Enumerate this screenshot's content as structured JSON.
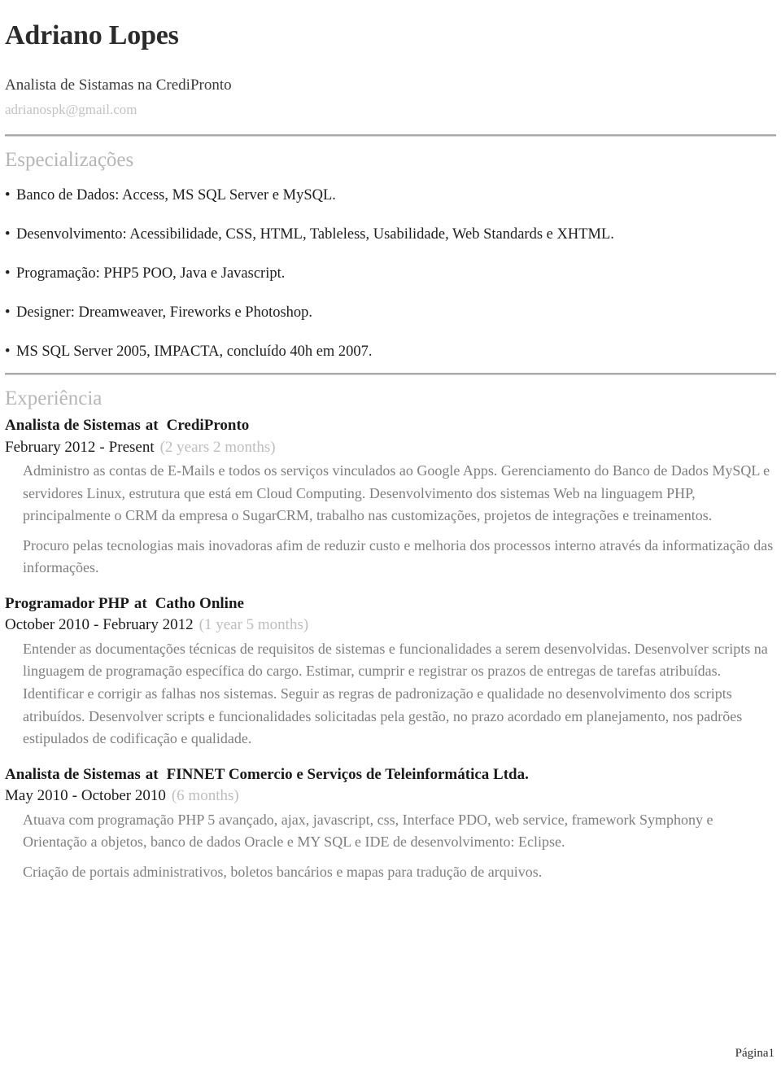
{
  "header": {
    "name": "Adriano Lopes",
    "headline": "Analista de Sistamas na CrediPronto",
    "email": "adrianospk@gmail.com"
  },
  "specializations": {
    "title": "Especializações",
    "bullet_glyph": "•",
    "items": [
      "Banco de Dados: Access, MS SQL Server e MySQL.",
      "Desenvolvimento: Acessibilidade, CSS, HTML, Tableless, Usabilidade, Web Standards e XHTML.",
      "Programação: PHP5 POO, Java e Javascript.",
      "Designer: Dreamweaver, Fireworks e Photoshop.",
      "MS SQL Server 2005, IMPACTA, concluído 40h em 2007."
    ]
  },
  "experience": {
    "title": "Experiência",
    "at_label": "at",
    "dash": "-",
    "jobs": [
      {
        "role": "Analista de Sistemas",
        "company": "CrediPronto",
        "start": "February 2012",
        "end": "Present",
        "duration": "(2 years 2 months)",
        "paragraphs": [
          "Administro as contas de E-Mails e todos os serviços vinculados ao Google Apps. Gerenciamento do Banco de Dados MySQL e servidores Linux, estrutura que está em Cloud Computing. Desenvolvimento dos sistemas Web na linguagem PHP, principalmente o CRM da empresa o SugarCRM, trabalho nas customizações, projetos de integrações e treinamentos.",
          "Procuro pelas tecnologias mais inovadoras afim de reduzir custo e melhoria dos processos interno através da informatização das informações."
        ]
      },
      {
        "role": "Programador PHP",
        "company": "Catho Online",
        "start": "October 2010",
        "end": "February 2012",
        "duration": "(1 year 5 months)",
        "paragraphs": [
          "Entender as documentações técnicas de requisitos de sistemas e funcionalidades a serem desenvolvidas. Desenvolver scripts na linguagem de programação específica do cargo. Estimar, cumprir e registrar os prazos de entregas de tarefas atribuídas. Identificar e corrigir as falhas nos sistemas. Seguir as regras de padronização e qualidade no desenvolvimento dos scripts atribuídos. Desenvolver scripts e funcionalidades solicitadas pela gestão, no prazo acordado em planejamento, nos padrões estipulados de codificação e qualidade."
        ]
      },
      {
        "role": "Analista de Sistemas",
        "company": "FINNET Comercio e Serviços de Teleinformática Ltda.",
        "start": "May 2010",
        "end": "October 2010",
        "duration": "(6 months)",
        "paragraphs": [
          "Atuava com programação PHP 5 avançado, ajax, javascript, css, Interface PDO, web service, framework Symphony e Orientação a objetos, banco de dados Oracle e MY SQL e IDE de desenvolvimento: Eclipse.",
          "Criação de portais administrativos, boletos bancários e mapas para tradução de arquivos."
        ]
      }
    ]
  },
  "footer": {
    "page_label": "Página1"
  }
}
